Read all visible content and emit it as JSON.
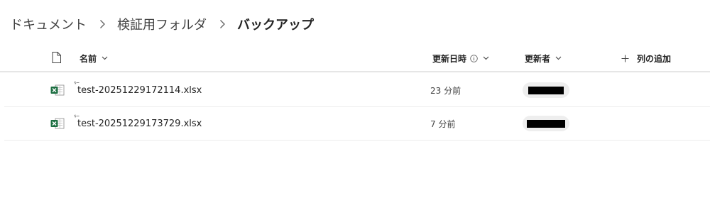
{
  "breadcrumb": {
    "items": [
      "ドキュメント",
      "検証用フォルダ"
    ],
    "current": "バックアップ"
  },
  "columns": {
    "name": "名前",
    "modified": "更新日時",
    "modified_by": "更新者",
    "add_column": "列の追加"
  },
  "files": [
    {
      "name": "test-20251229172114.xlsx",
      "modified": "23 分前",
      "icon": "excel-file-icon",
      "is_new": true,
      "modified_by_redacted": true
    },
    {
      "name": "test-20251229173729.xlsx",
      "modified": "7 分前",
      "icon": "excel-file-icon",
      "is_new": true,
      "modified_by_redacted": true
    }
  ],
  "colors": {
    "excel_green": "#1d6f42",
    "redaction": "#000000",
    "chip_bg": "#eeeeee"
  }
}
